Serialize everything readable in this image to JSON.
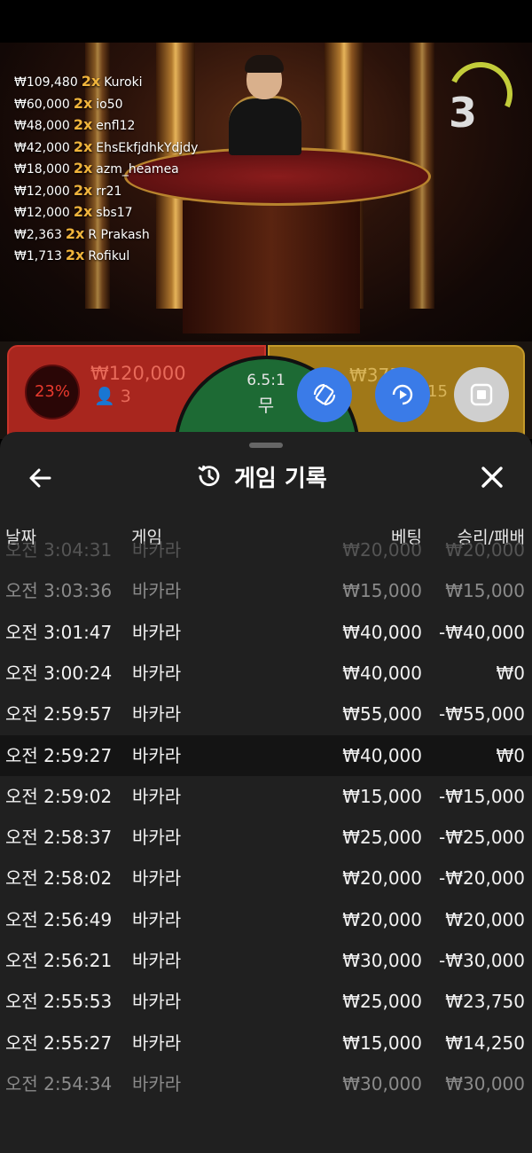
{
  "stream": {
    "round_number": "3",
    "winners": [
      {
        "amount": "₩109,480",
        "multiplier": "2x",
        "name": "Kuroki"
      },
      {
        "amount": "₩60,000",
        "multiplier": "2x",
        "name": "io50"
      },
      {
        "amount": "₩48,000",
        "multiplier": "2x",
        "name": "enfl12"
      },
      {
        "amount": "₩42,000",
        "multiplier": "2x",
        "name": "EhsEkfjdhkYdjdy"
      },
      {
        "amount": "₩18,000",
        "multiplier": "2x",
        "name": "azm_heamea"
      },
      {
        "amount": "₩12,000",
        "multiplier": "2x",
        "name": "rr21"
      },
      {
        "amount": "₩12,000",
        "multiplier": "2x",
        "name": "sbs17"
      },
      {
        "amount": "₩2,363",
        "multiplier": "2x",
        "name": "R Prakash"
      },
      {
        "amount": "₩1,713",
        "multiplier": "2x",
        "name": "Rofikul"
      }
    ]
  },
  "bets": {
    "left_percent": "23%",
    "left_amount": "₩120,000",
    "left_players": "3",
    "tie_ratio": "6.5:1",
    "tie_label": "무",
    "right_amount": "₩375",
    "right_amount_tail": "17",
    "right_players": "15"
  },
  "history": {
    "title": "게임 기록",
    "columns": {
      "date": "날짜",
      "game": "게임",
      "bet": "베팅",
      "result": "승리/패배"
    },
    "rows": [
      {
        "time": "오전 3:04:31",
        "game": "바카라",
        "bet": "₩20,000",
        "result": "₩20,000"
      },
      {
        "time": "오전 3:03:36",
        "game": "바카라",
        "bet": "₩15,000",
        "result": "₩15,000"
      },
      {
        "time": "오전 3:01:47",
        "game": "바카라",
        "bet": "₩40,000",
        "result": "-₩40,000"
      },
      {
        "time": "오전 3:00:24",
        "game": "바카라",
        "bet": "₩40,000",
        "result": "₩0"
      },
      {
        "time": "오전 2:59:57",
        "game": "바카라",
        "bet": "₩55,000",
        "result": "-₩55,000"
      },
      {
        "time": "오전 2:59:27",
        "game": "바카라",
        "bet": "₩40,000",
        "result": "₩0"
      },
      {
        "time": "오전 2:59:02",
        "game": "바카라",
        "bet": "₩15,000",
        "result": "-₩15,000"
      },
      {
        "time": "오전 2:58:37",
        "game": "바카라",
        "bet": "₩25,000",
        "result": "-₩25,000"
      },
      {
        "time": "오전 2:58:02",
        "game": "바카라",
        "bet": "₩20,000",
        "result": "-₩20,000"
      },
      {
        "time": "오전 2:56:49",
        "game": "바카라",
        "bet": "₩20,000",
        "result": "₩20,000"
      },
      {
        "time": "오전 2:56:21",
        "game": "바카라",
        "bet": "₩30,000",
        "result": "-₩30,000"
      },
      {
        "time": "오전 2:55:53",
        "game": "바카라",
        "bet": "₩25,000",
        "result": "₩23,750"
      },
      {
        "time": "오전 2:55:27",
        "game": "바카라",
        "bet": "₩15,000",
        "result": "₩14,250"
      },
      {
        "time": "오전 2:54:34",
        "game": "바카라",
        "bet": "₩30,000",
        "result": "₩30,000"
      }
    ]
  }
}
